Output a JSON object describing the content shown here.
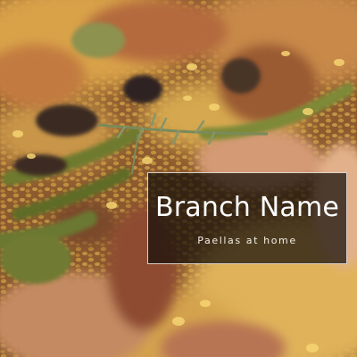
{
  "hero": {
    "image_subject": "paella-photo",
    "title": "Branch Name",
    "subtitle": "Paellas at home"
  },
  "colors": {
    "overlay": "#140e0a",
    "overlay_border": "#f5f0e8",
    "text": "#ffffff"
  }
}
